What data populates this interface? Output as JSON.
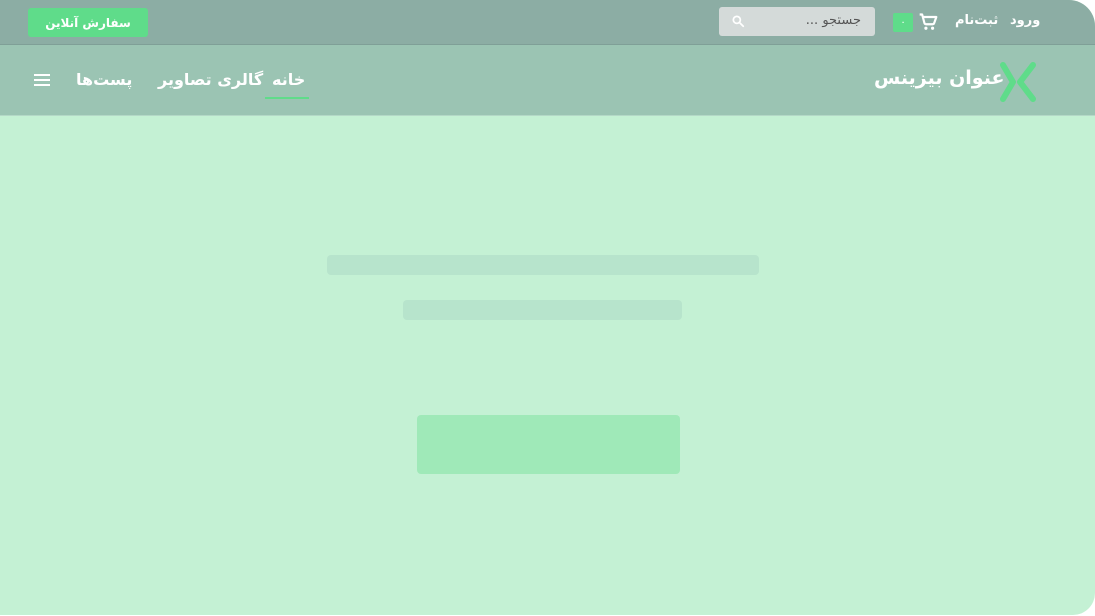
{
  "topbar": {
    "order_button_label": "سفارش آنلاین",
    "search_placeholder": "جستجو ...",
    "cart_count": "۰",
    "signup_label": "ثبت‌نام",
    "login_label": "ورود",
    "icons": {
      "search": "search-icon",
      "cart": "cart-icon"
    }
  },
  "navbar": {
    "brand_title": "عنوان بیزینس",
    "items": [
      {
        "label": "خانه",
        "active": true
      },
      {
        "label": "گالری تصاویر"
      },
      {
        "label": "پست‌ها"
      }
    ],
    "icons": {
      "menu": "menu-icon",
      "logo": "brand-logo"
    }
  },
  "colors": {
    "accent": "#5fdc8a",
    "topbar_bg": "#8cada4",
    "navbar_bg": "#9bc4b3",
    "page_bg": "#c4f1d4"
  }
}
